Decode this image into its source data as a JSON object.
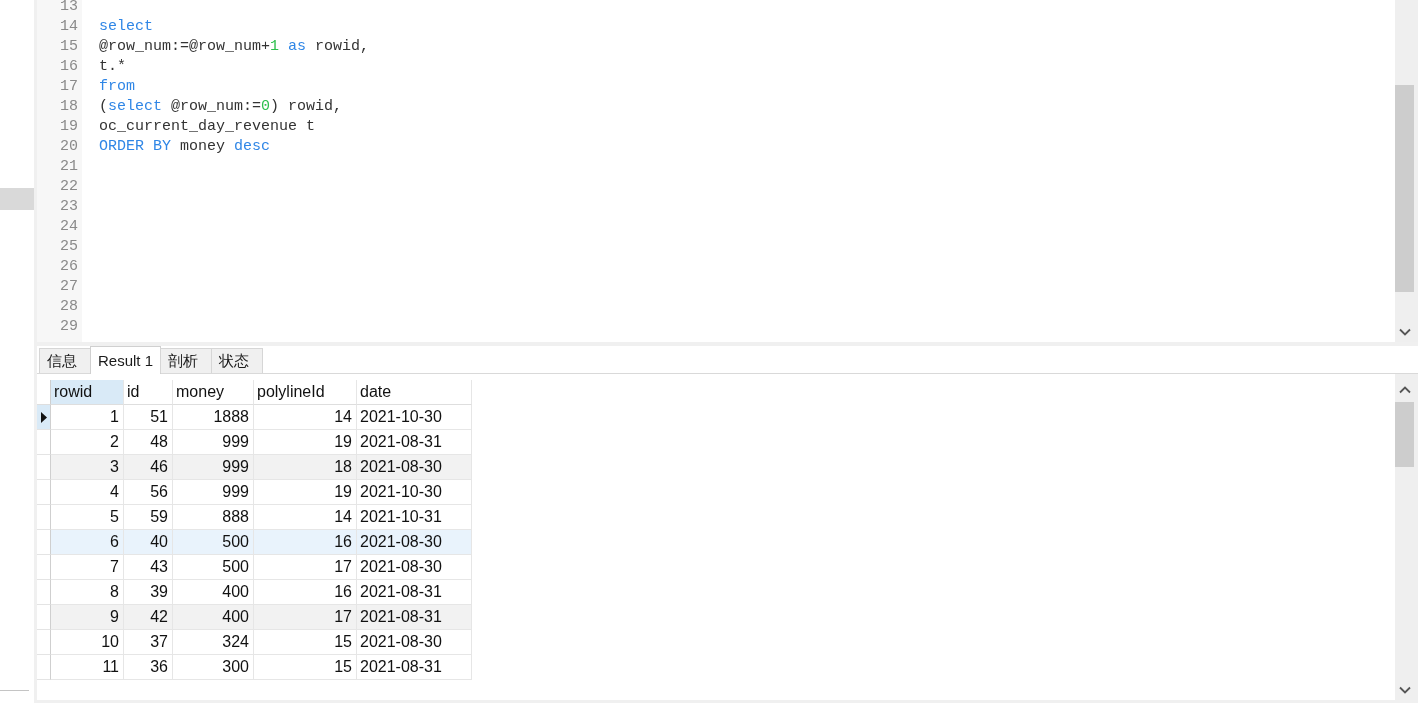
{
  "editor": {
    "lines": [
      {
        "number": "13"
      },
      {
        "number": "14",
        "tokens": [
          {
            "text": "select",
            "kind": "keyword"
          }
        ]
      },
      {
        "number": "15",
        "tokens": [
          {
            "text": "@row_num:=@row_num+",
            "kind": "plain"
          },
          {
            "text": "1",
            "kind": "number"
          },
          {
            "text": " as",
            "kind": "keyword"
          },
          {
            "text": " rowid,",
            "kind": "plain"
          }
        ]
      },
      {
        "number": "16",
        "tokens": [
          {
            "text": "t.*",
            "kind": "plain"
          }
        ]
      },
      {
        "number": "17",
        "tokens": [
          {
            "text": "from",
            "kind": "keyword"
          }
        ]
      },
      {
        "number": "18",
        "tokens": [
          {
            "text": "(",
            "kind": "plain"
          },
          {
            "text": "select",
            "kind": "keyword"
          },
          {
            "text": " @row_num:=",
            "kind": "plain"
          },
          {
            "text": "0",
            "kind": "number"
          },
          {
            "text": ") rowid,",
            "kind": "plain"
          }
        ]
      },
      {
        "number": "19",
        "tokens": [
          {
            "text": "oc_current_day_revenue t",
            "kind": "plain"
          }
        ]
      },
      {
        "number": "20",
        "tokens": [
          {
            "text": "ORDER BY",
            "kind": "keyword"
          },
          {
            "text": " money ",
            "kind": "plain"
          },
          {
            "text": "desc",
            "kind": "keyword"
          }
        ]
      },
      {
        "number": "21"
      },
      {
        "number": "22"
      },
      {
        "number": "23"
      },
      {
        "number": "24"
      },
      {
        "number": "25"
      },
      {
        "number": "26"
      },
      {
        "number": "27"
      },
      {
        "number": "28"
      },
      {
        "number": "29"
      }
    ]
  },
  "results": {
    "tabs": [
      {
        "label": "信息",
        "selected": false
      },
      {
        "label": "Result 1",
        "selected": true
      },
      {
        "label": "剖析",
        "selected": false
      },
      {
        "label": "状态",
        "selected": false
      }
    ],
    "grid": {
      "columns": [
        {
          "label": "rowid",
          "kind": "number",
          "selected": true
        },
        {
          "label": "id",
          "kind": "number",
          "selected": false
        },
        {
          "label": "money",
          "kind": "number",
          "selected": false
        },
        {
          "label": "polylineId",
          "kind": "number",
          "selected": false
        },
        {
          "label": "date",
          "kind": "text",
          "selected": false
        }
      ],
      "rows": [
        {
          "selected": true,
          "shaded": false,
          "hovered": false,
          "cells": [
            "1",
            "51",
            "1888",
            "14",
            "2021-10-30"
          ]
        },
        {
          "selected": false,
          "shaded": false,
          "hovered": false,
          "cells": [
            "2",
            "48",
            "999",
            "19",
            "2021-08-31"
          ]
        },
        {
          "selected": false,
          "shaded": true,
          "hovered": false,
          "cells": [
            "3",
            "46",
            "999",
            "18",
            "2021-08-30"
          ]
        },
        {
          "selected": false,
          "shaded": false,
          "hovered": false,
          "cells": [
            "4",
            "56",
            "999",
            "19",
            "2021-10-30"
          ]
        },
        {
          "selected": false,
          "shaded": false,
          "hovered": false,
          "cells": [
            "5",
            "59",
            "888",
            "14",
            "2021-10-31"
          ]
        },
        {
          "selected": false,
          "shaded": false,
          "hovered": true,
          "cells": [
            "6",
            "40",
            "500",
            "16",
            "2021-08-30"
          ]
        },
        {
          "selected": false,
          "shaded": false,
          "hovered": false,
          "cells": [
            "7",
            "43",
            "500",
            "17",
            "2021-08-30"
          ]
        },
        {
          "selected": false,
          "shaded": false,
          "hovered": false,
          "cells": [
            "8",
            "39",
            "400",
            "16",
            "2021-08-31"
          ]
        },
        {
          "selected": false,
          "shaded": true,
          "hovered": false,
          "cells": [
            "9",
            "42",
            "400",
            "17",
            "2021-08-31"
          ]
        },
        {
          "selected": false,
          "shaded": false,
          "hovered": false,
          "cells": [
            "10",
            "37",
            "324",
            "15",
            "2021-08-30"
          ]
        },
        {
          "selected": false,
          "shaded": false,
          "hovered": false,
          "cells": [
            "11",
            "36",
            "300",
            "15",
            "2021-08-31"
          ]
        }
      ]
    }
  }
}
